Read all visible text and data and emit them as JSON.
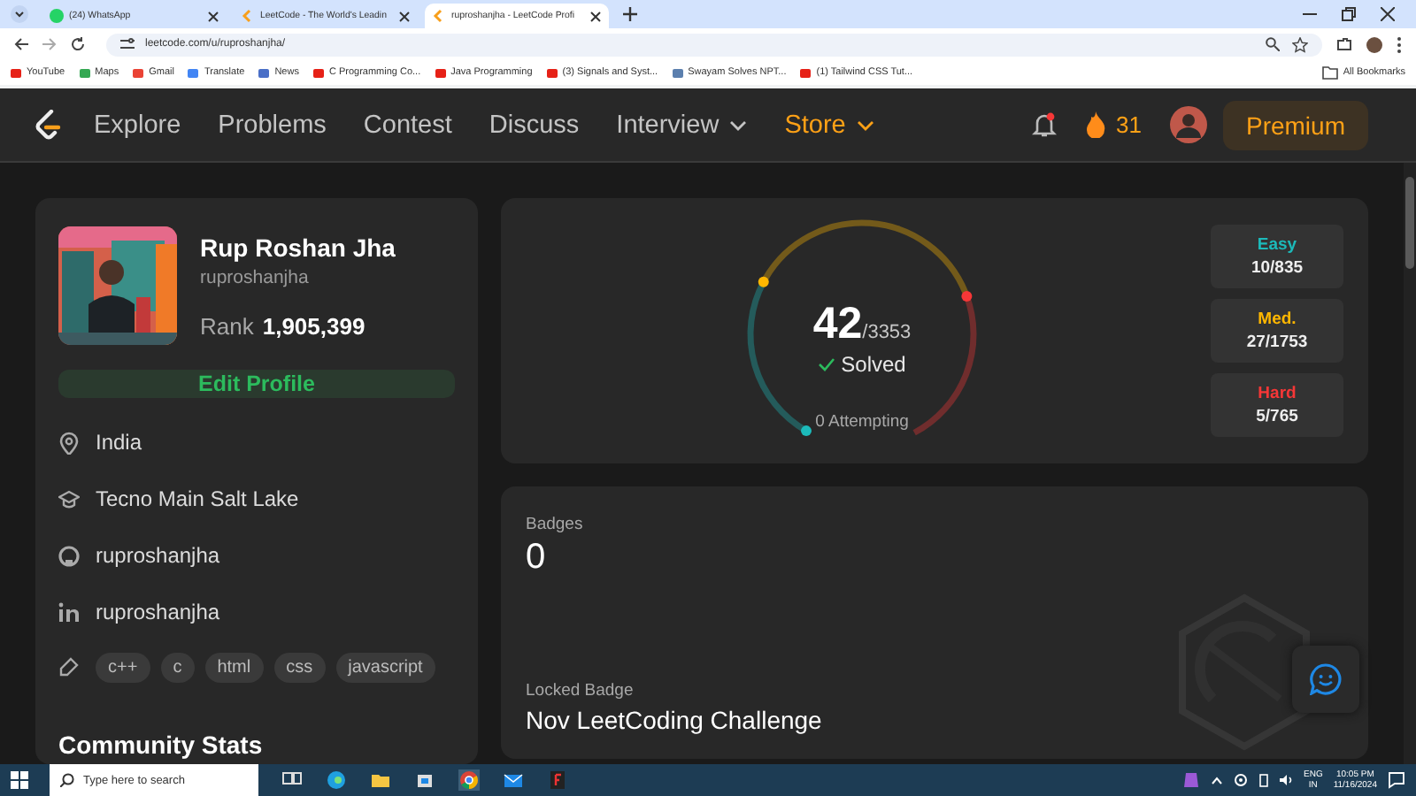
{
  "browser": {
    "tabs": [
      {
        "title": "(24) WhatsApp",
        "kind": "whatsapp",
        "selected": false
      },
      {
        "title": "LeetCode - The World's Leadin",
        "kind": "leetcode",
        "selected": false
      },
      {
        "title": "ruproshanjha - LeetCode Profi",
        "kind": "leetcode",
        "selected": true
      }
    ],
    "url": "leetcode.com/u/ruproshanjha/",
    "bookmarks": [
      {
        "title": "YouTube",
        "color": "#e62117"
      },
      {
        "title": "Maps",
        "color": "#34a853"
      },
      {
        "title": "Gmail",
        "color": "#ea4335"
      },
      {
        "title": "Translate",
        "color": "#4285f4"
      },
      {
        "title": "News",
        "color": "#4a6fc7"
      },
      {
        "title": "C Programming Co...",
        "color": "#e62117"
      },
      {
        "title": "Java Programming",
        "color": "#e62117"
      },
      {
        "title": "(3) Signals and Syst...",
        "color": "#e62117"
      },
      {
        "title": "Swayam Solves NPT...",
        "color": "#5b7fae"
      },
      {
        "title": "(1) Tailwind CSS Tut...",
        "color": "#e62117"
      }
    ],
    "all_bookmarks": "All Bookmarks"
  },
  "nav": {
    "items": [
      {
        "label": "Explore",
        "kind": "link"
      },
      {
        "label": "Problems",
        "kind": "link"
      },
      {
        "label": "Contest",
        "kind": "link"
      },
      {
        "label": "Discuss",
        "kind": "link"
      },
      {
        "label": "Interview",
        "kind": "dropdown"
      },
      {
        "label": "Store",
        "kind": "store"
      }
    ],
    "streak": "31",
    "premium": "Premium"
  },
  "profile": {
    "name": "Rup Roshan Jha",
    "username": "ruproshanjha",
    "rank_label": "Rank",
    "rank": "1,905,399",
    "edit_button": "Edit Profile",
    "details": [
      {
        "kind": "location",
        "text": "India"
      },
      {
        "kind": "school",
        "text": "Tecno Main Salt Lake"
      },
      {
        "kind": "github",
        "text": "ruproshanjha"
      },
      {
        "kind": "linkedin",
        "text": "ruproshanjha"
      }
    ],
    "skills": [
      "c++",
      "c",
      "html",
      "css",
      "javascript"
    ],
    "section_title": "Community Stats"
  },
  "progress": {
    "solved": "42",
    "total": "/3353",
    "solved_label": "Solved",
    "attempting": "0 Attempting",
    "difficulties": [
      {
        "label": "Easy",
        "count": "10/835",
        "color": "#1cbaba"
      },
      {
        "label": "Med.",
        "count": "27/1753",
        "color": "#ffb700"
      },
      {
        "label": "Hard",
        "count": "5/765",
        "color": "#f63737"
      }
    ]
  },
  "badges": {
    "label": "Badges",
    "count": "0",
    "locked_label": "Locked Badge",
    "locked_name": "Nov LeetCoding Challenge"
  },
  "taskbar": {
    "search_placeholder": "Type here to search",
    "language": "ENG",
    "region": "IN",
    "time": "10:05 PM",
    "date": "11/16/2024"
  }
}
